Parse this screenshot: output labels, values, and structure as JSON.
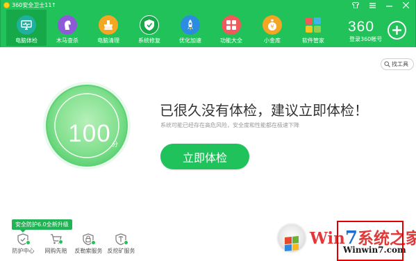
{
  "titlebar": {
    "app_title": "360安全卫士11",
    "up_arrow": "↑",
    "buttons": [
      "shirt-icon",
      "menu-icon",
      "minimize-icon",
      "close-icon"
    ]
  },
  "nav": {
    "items": [
      {
        "label": "电脑体检",
        "icon": "monitor-icon",
        "color": "#1fb0a0",
        "active": true
      },
      {
        "label": "木马查杀",
        "icon": "horse-icon",
        "color": "#8e5ad8"
      },
      {
        "label": "电脑清理",
        "icon": "broom-icon",
        "color": "#f5a623"
      },
      {
        "label": "系统修复",
        "icon": "shield-icon",
        "color": "#17a849"
      },
      {
        "label": "优化加速",
        "icon": "rocket-icon",
        "color": "#2c8de0"
      },
      {
        "label": "功能大全",
        "icon": "grid-icon",
        "color": "#f05a5a"
      },
      {
        "label": "小金库",
        "icon": "money-bag-icon",
        "color": "#f2a623"
      },
      {
        "label": "软件管家",
        "icon": "apps-icon",
        "color": "#3fb5e8"
      }
    ]
  },
  "account": {
    "brand": "360",
    "login_label": "登录360帐号"
  },
  "tools": {
    "find_label": "找工具"
  },
  "score": {
    "value": "100",
    "unit": "分",
    "fill_fraction": 1.0
  },
  "main": {
    "headline": "已很久没有体检，建议立即体检！",
    "subline": "系统可能已经存在高危风险，安全度和性能都在极速下降",
    "scan_button": "立即体检"
  },
  "bottom": {
    "upgrade_badge": "安全防护6.0全新升级",
    "services": [
      {
        "label": "防护中心",
        "icon": "shield-center-icon"
      },
      {
        "label": "网购先赔",
        "icon": "shopping-guarantee-icon"
      },
      {
        "label": "反勒索服务",
        "icon": "anti-ransom-icon"
      },
      {
        "label": "反挖矿服务",
        "icon": "anti-mining-icon"
      }
    ]
  },
  "watermark": {
    "brand_prefix": "Win",
    "brand_seven": "7",
    "brand_suffix": "系统之家",
    "url": "Winwin7.com"
  },
  "colors": {
    "primary_green": "#21c25a",
    "active_green": "#17a849",
    "text_dark": "#333333",
    "text_muted": "#999999"
  }
}
